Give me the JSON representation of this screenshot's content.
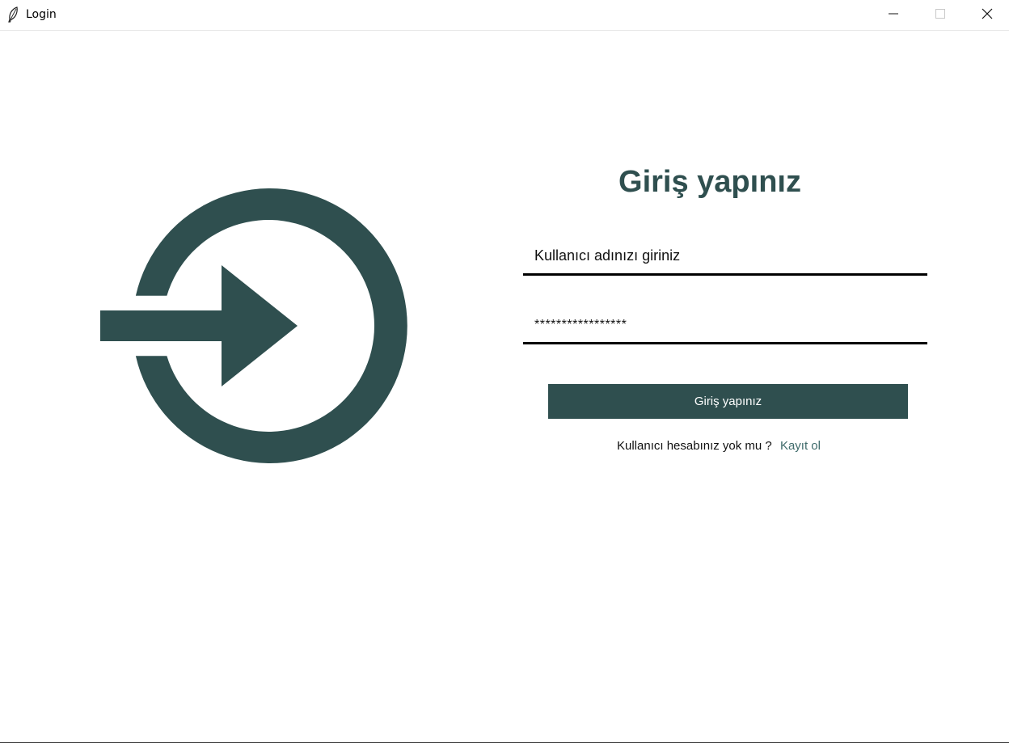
{
  "window": {
    "title": "Login",
    "app_icon": "feather-icon",
    "controls": {
      "minimize_icon": "minimize-icon",
      "maximize_icon": "maximize-icon",
      "close_icon": "close-icon"
    }
  },
  "logo": {
    "icon": "login-arrow-icon",
    "color": "#2f4f4f"
  },
  "form": {
    "heading": "Giriş yapınız",
    "username": {
      "value": "Kullanıcı adınızı giriniz",
      "placeholder": ""
    },
    "password": {
      "value": "*****************",
      "placeholder": ""
    },
    "submit_label": "Giriş yapınız",
    "register_prompt": "Kullanıcı hesabınız yok mu ?",
    "register_link": "Kayıt ol"
  },
  "colors": {
    "accent": "#2f4f4f",
    "link": "#3f6b6b",
    "background": "#ffffff"
  }
}
